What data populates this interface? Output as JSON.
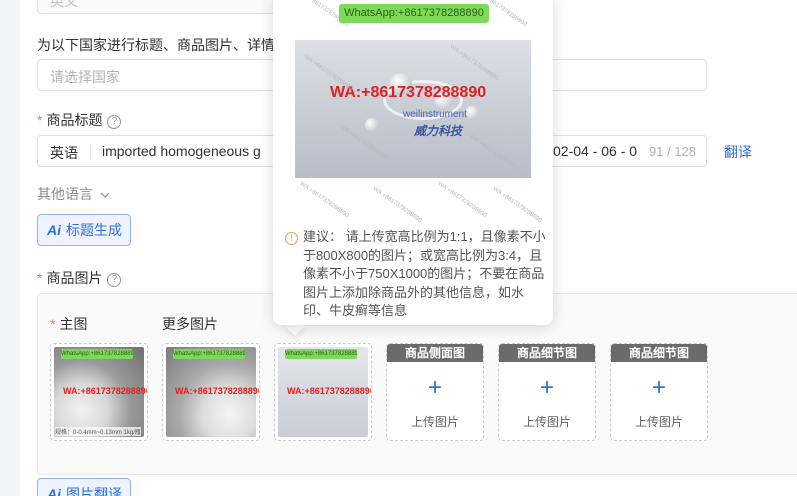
{
  "top_field": {
    "value": "英文"
  },
  "country_section": {
    "label": "为以下国家进行标题、商品图片、详情",
    "placeholder": "请选择国家"
  },
  "title_section": {
    "label": "商品标题",
    "language": "英语",
    "value": "imported homogeneous g",
    "value_tail": "02-04 - 06 - 0",
    "count": "91 / 128",
    "translate": "翻译",
    "other_languages": "其他语言",
    "ai_button": "标题生成",
    "ai_icon": "Ai"
  },
  "images_section": {
    "label": "商品图片",
    "main_label": "主图",
    "more_label": "更多图片",
    "thumbnails": [
      {
        "wa_green": "WhatsApp:+8617378288890",
        "wa_red": "WA:+8617378288890",
        "footer": "规格：0-0.4mm~0.13mm 1kg/瓶"
      },
      {
        "wa_green": "WhatsApp:+8617378288890",
        "wa_red": "WA:+8617378288890",
        "footer": ""
      },
      {
        "wa_green": "WhatsApp:+8617378288890",
        "wa_red": "WA:+8617378288890",
        "footer": ""
      }
    ],
    "upload_slots": [
      {
        "band": "商品侧面图",
        "plus": "+",
        "text": "上传图片"
      },
      {
        "band": "商品细节图",
        "plus": "+",
        "text": "上传图片"
      },
      {
        "band": "商品细节图",
        "plus": "+",
        "text": "上传图片"
      }
    ],
    "ai_button": "图片翻译"
  },
  "popover": {
    "wa_green": "WhatsApp:+8617378288890",
    "wa_red": "WA:+8617378288890",
    "brand": "weilinstrument",
    "brand_cn": "威力科技",
    "watermark": "WA:+8617378288890",
    "tip_icon": "!",
    "tip": "建议： 请上传宽高比例为1:1，且像素不小于800X800的图片；或宽高比例为3:4，且像素不小于750X1000的图片；不要在商品图片上添加除商品外的其他信息，如水印、牛皮癣等信息"
  },
  "colors": {
    "accent": "#2f6fd6",
    "required": "#f56c6c",
    "warning": "#e6a23c",
    "watermark_green": "#7ed957",
    "watermark_red": "#e02020"
  }
}
